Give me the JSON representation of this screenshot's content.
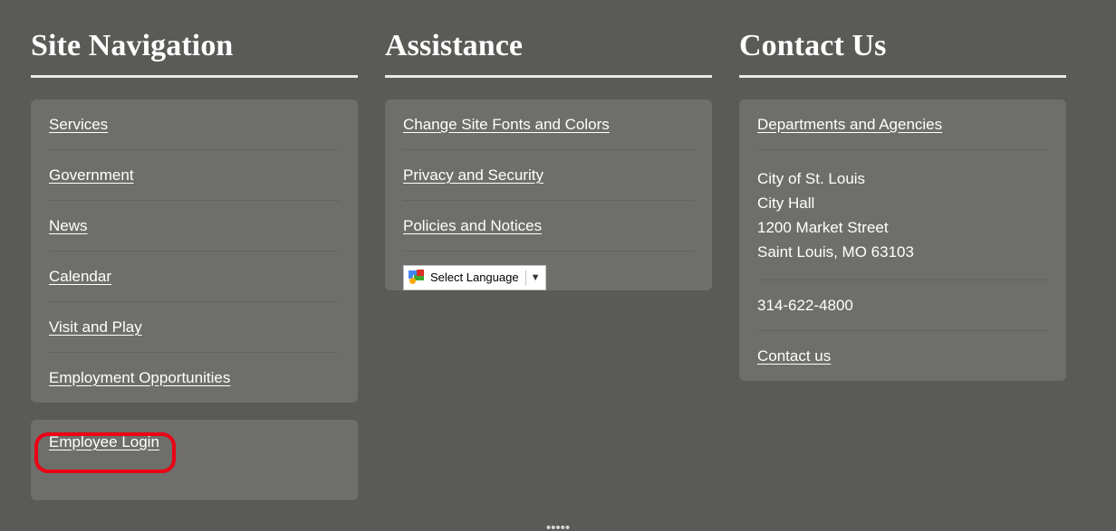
{
  "page": {
    "background_color": "#5a5a57",
    "panel_color": "#6e6e6b",
    "highlight_color": "#ec0016"
  },
  "columns": [
    {
      "heading": "Site Navigation",
      "links": [
        {
          "label": "Services"
        },
        {
          "label": "Government"
        },
        {
          "label": "News"
        },
        {
          "label": "Calendar"
        },
        {
          "label": "Visit and Play"
        },
        {
          "label": "Employment Opportunities"
        }
      ],
      "login": {
        "label": "Employee Login"
      }
    },
    {
      "heading": "Assistance",
      "links": [
        {
          "label": "Change Site Fonts and Colors"
        },
        {
          "label": "Privacy and Security"
        },
        {
          "label": "Policies and Notices"
        }
      ],
      "translate": {
        "label": "Select Language",
        "caret": "▼",
        "icon": "google-translate-icon"
      }
    },
    {
      "heading": "Contact Us",
      "departments_link": "Departments and Agencies",
      "address": [
        "City of St. Louis",
        "City Hall",
        "1200 Market Street",
        "Saint Louis, MO 63103"
      ],
      "phone": "314-622-4800",
      "contact_link": "Contact us"
    }
  ],
  "bottom_clipped_text": "•••••"
}
